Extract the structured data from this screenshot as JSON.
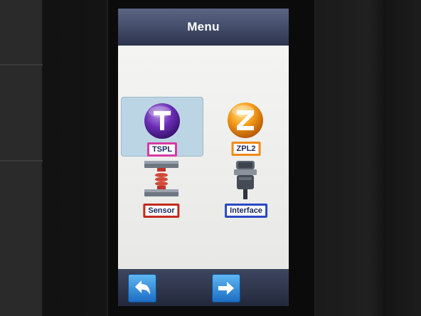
{
  "header": {
    "title": "Menu"
  },
  "menu": {
    "items": [
      {
        "label": "TSPL",
        "icon": "tspl-t-icon",
        "selected": true,
        "border_color": "#d63aa3"
      },
      {
        "label": "ZPL2",
        "icon": "zpl2-z-icon",
        "selected": false,
        "border_color": "#f08a18"
      },
      {
        "label": "Sensor",
        "icon": "sensor-icon",
        "selected": false,
        "border_color": "#c22a1e"
      },
      {
        "label": "Interface",
        "icon": "serial-connector-icon",
        "selected": false,
        "border_color": "#2a48c4"
      }
    ]
  },
  "footer": {
    "back_icon": "back-arrow-icon",
    "next_icon": "next-arrow-icon"
  },
  "colors": {
    "selection": "#bcd5e4",
    "nav_button": "#2f8ee0",
    "title_bar": "#3f4864"
  }
}
